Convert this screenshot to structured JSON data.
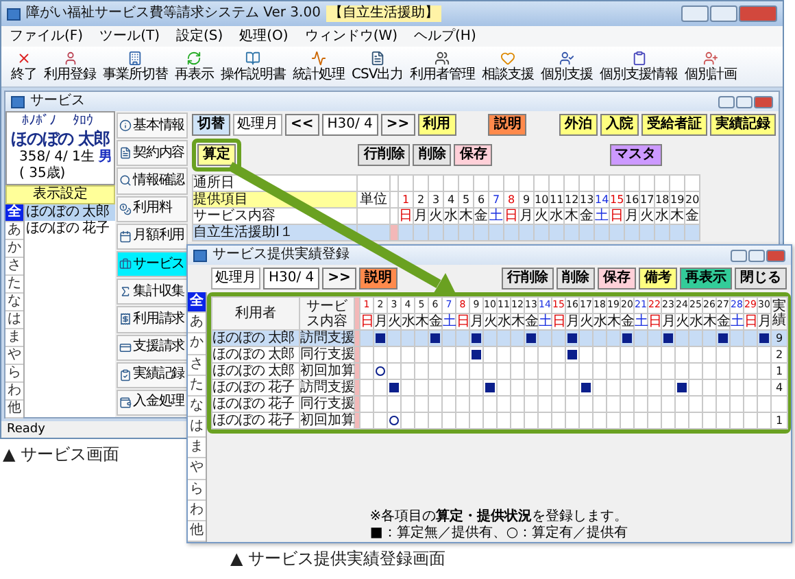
{
  "app": {
    "title": "障がい福祉サービス費等請求システム Ver 3.00",
    "badge": "【自立生活援助】",
    "menu": [
      "ファイル(F)",
      "ツール(T)",
      "設定(S)",
      "処理(O)",
      "ウィンドウ(W)",
      "ヘルプ(H)"
    ],
    "toolbar": [
      "終了",
      "利用登録",
      "事業所切替",
      "再表示",
      "操作説明書",
      "統計処理",
      "CSV出力",
      "利用者管理",
      "相談支援",
      "個別支援",
      "個別支援情報",
      "個別計画"
    ],
    "status": "Ready"
  },
  "service_window": {
    "title": "サービス",
    "user": {
      "furigana_family": "ﾎﾉﾎﾞﾉ",
      "furigana_given": "ﾀﾛｳ",
      "name": "ほのぼの 太郎",
      "birth": "358/ 4/ 1生",
      "gender": "男",
      "age": "( 35歳)"
    },
    "display_settings": "表示設定",
    "kana": [
      {
        "label": "全",
        "selected": true
      },
      {
        "label": "あ",
        "selected": false
      },
      {
        "label": "か",
        "selected": false
      },
      {
        "label": "さ",
        "selected": false
      },
      {
        "label": "た",
        "selected": false
      },
      {
        "label": "な",
        "selected": false
      },
      {
        "label": "は",
        "selected": false
      },
      {
        "label": "ま",
        "selected": false
      },
      {
        "label": "や",
        "selected": false
      },
      {
        "label": "ら",
        "selected": false
      },
      {
        "label": "わ",
        "selected": false
      },
      {
        "label": "他",
        "selected": false
      }
    ],
    "users": [
      {
        "name": "ほのぼの 太郎",
        "selected": true
      },
      {
        "name": "ほのぼの 花子",
        "selected": false
      }
    ],
    "nav": [
      {
        "label": "基本情報",
        "selected": false
      },
      {
        "label": "契約内容",
        "selected": false
      },
      {
        "label": "情報確認",
        "selected": false
      },
      {
        "label": "利用料",
        "selected": false
      },
      {
        "label": "月額利用",
        "selected": false
      },
      {
        "label": "サービス",
        "selected": true
      },
      {
        "label": "集計収集",
        "selected": false
      },
      {
        "label": "利用請求",
        "selected": false
      },
      {
        "label": "支援請求",
        "selected": false
      },
      {
        "label": "実績記録",
        "selected": false
      },
      {
        "label": "入金処理",
        "selected": false
      }
    ],
    "month_controls": [
      {
        "kind": "button",
        "label": "切替",
        "color": "#cfe3f7"
      },
      {
        "kind": "label",
        "label": "処理月"
      },
      {
        "kind": "button",
        "label": "<<",
        "color": "#f4f4f4"
      },
      {
        "kind": "field",
        "label": "H30/ 4"
      },
      {
        "kind": "button",
        "label": ">>",
        "color": "#f4f4f4"
      },
      {
        "kind": "button",
        "label": "利用",
        "color": "#ffff80"
      }
    ],
    "help_button": {
      "label": "説明",
      "color": "#ff8a4c"
    },
    "stay_buttons": [
      {
        "label": "外泊",
        "color": "#ffff80"
      },
      {
        "label": "入院",
        "color": "#ffff80"
      },
      {
        "label": "受給者証",
        "color": "#ffff80"
      },
      {
        "label": "実績記録",
        "color": "#ffff80"
      }
    ],
    "calc_button": {
      "label": "算定",
      "color": "#ffff99",
      "highlighted": true
    },
    "edit_buttons": [
      {
        "label": "行削除",
        "color": "#e4e4e4"
      },
      {
        "label": "削除",
        "color": "#e4e4e4"
      },
      {
        "label": "保存",
        "color": "#ffd0d8"
      }
    ],
    "master_button": {
      "label": "マスタ",
      "color": "#cc99ff"
    },
    "grid": {
      "visit_label": "通所日",
      "item_label": "提供項目",
      "unit_label": "単位",
      "content_label": "サービス内容",
      "days": [
        {
          "day": "1",
          "weekday": "日",
          "kind": "sunday"
        },
        {
          "day": "2",
          "weekday": "月",
          "kind": "weekday"
        },
        {
          "day": "3",
          "weekday": "火",
          "kind": "weekday"
        },
        {
          "day": "4",
          "weekday": "水",
          "kind": "weekday"
        },
        {
          "day": "5",
          "weekday": "木",
          "kind": "weekday"
        },
        {
          "day": "6",
          "weekday": "金",
          "kind": "weekday"
        },
        {
          "day": "7",
          "weekday": "土",
          "kind": "saturday"
        },
        {
          "day": "8",
          "weekday": "日",
          "kind": "sunday"
        },
        {
          "day": "9",
          "weekday": "月",
          "kind": "weekday"
        },
        {
          "day": "10",
          "weekday": "火",
          "kind": "weekday"
        },
        {
          "day": "11",
          "weekday": "水",
          "kind": "weekday"
        },
        {
          "day": "12",
          "weekday": "木",
          "kind": "weekday"
        },
        {
          "day": "13",
          "weekday": "金",
          "kind": "weekday"
        },
        {
          "day": "14",
          "weekday": "土",
          "kind": "saturday"
        },
        {
          "day": "15",
          "weekday": "日",
          "kind": "sunday"
        },
        {
          "day": "16",
          "weekday": "月",
          "kind": "weekday"
        },
        {
          "day": "17",
          "weekday": "火",
          "kind": "weekday"
        },
        {
          "day": "18",
          "weekday": "水",
          "kind": "weekday"
        },
        {
          "day": "19",
          "weekday": "木",
          "kind": "weekday"
        },
        {
          "day": "20",
          "weekday": "金",
          "kind": "weekday"
        }
      ],
      "rows": [
        {
          "label": "自立生活援助Ⅰ１",
          "selected": true
        }
      ]
    }
  },
  "caption_1": "▲ サービス画面",
  "entry_window": {
    "title": "サービス提供実績登録",
    "month_label": "処理月",
    "month": "H30/ 4",
    "next": ">>",
    "help_button": {
      "label": "説明",
      "color": "#ff8a4c"
    },
    "buttons": [
      {
        "label": "行削除",
        "color": "#e4e4e4"
      },
      {
        "label": "削除",
        "color": "#e4e4e4"
      },
      {
        "label": "保存",
        "color": "#ffd0d8"
      },
      {
        "label": "備考",
        "color": "#ffff80"
      },
      {
        "label": "再表示",
        "color": "#33cc99"
      },
      {
        "label": "閉じる",
        "color": "#e4e4e4"
      }
    ],
    "kana": [
      {
        "label": "全",
        "selected": true
      },
      {
        "label": "あ",
        "selected": false
      },
      {
        "label": "か",
        "selected": false
      },
      {
        "label": "さ",
        "selected": false
      },
      {
        "label": "た",
        "selected": false
      },
      {
        "label": "な",
        "selected": false
      },
      {
        "label": "は",
        "selected": false
      },
      {
        "label": "ま",
        "selected": false
      },
      {
        "label": "や",
        "selected": false
      },
      {
        "label": "ら",
        "selected": false
      },
      {
        "label": "わ",
        "selected": false
      },
      {
        "label": "他",
        "selected": false
      }
    ],
    "grid": {
      "highlighted": true,
      "user_label": "利用者",
      "content_label": "サービス内容",
      "count_label": "実績",
      "days": [
        {
          "day": "1",
          "weekday": "日",
          "kind": "sunday"
        },
        {
          "day": "2",
          "weekday": "月",
          "kind": "weekday"
        },
        {
          "day": "3",
          "weekday": "火",
          "kind": "weekday"
        },
        {
          "day": "4",
          "weekday": "水",
          "kind": "weekday"
        },
        {
          "day": "5",
          "weekday": "木",
          "kind": "weekday"
        },
        {
          "day": "6",
          "weekday": "金",
          "kind": "weekday"
        },
        {
          "day": "7",
          "weekday": "土",
          "kind": "saturday"
        },
        {
          "day": "8",
          "weekday": "日",
          "kind": "sunday"
        },
        {
          "day": "9",
          "weekday": "月",
          "kind": "weekday"
        },
        {
          "day": "10",
          "weekday": "火",
          "kind": "weekday"
        },
        {
          "day": "11",
          "weekday": "水",
          "kind": "weekday"
        },
        {
          "day": "12",
          "weekday": "木",
          "kind": "weekday"
        },
        {
          "day": "13",
          "weekday": "金",
          "kind": "weekday"
        },
        {
          "day": "14",
          "weekday": "土",
          "kind": "saturday"
        },
        {
          "day": "15",
          "weekday": "日",
          "kind": "sunday"
        },
        {
          "day": "16",
          "weekday": "月",
          "kind": "weekday"
        },
        {
          "day": "17",
          "weekday": "火",
          "kind": "weekday"
        },
        {
          "day": "18",
          "weekday": "水",
          "kind": "weekday"
        },
        {
          "day": "19",
          "weekday": "木",
          "kind": "weekday"
        },
        {
          "day": "20",
          "weekday": "金",
          "kind": "weekday"
        },
        {
          "day": "21",
          "weekday": "土",
          "kind": "saturday"
        },
        {
          "day": "22",
          "weekday": "日",
          "kind": "sunday"
        },
        {
          "day": "23",
          "weekday": "月",
          "kind": "weekday"
        },
        {
          "day": "24",
          "weekday": "火",
          "kind": "weekday"
        },
        {
          "day": "25",
          "weekday": "水",
          "kind": "weekday"
        },
        {
          "day": "26",
          "weekday": "木",
          "kind": "weekday"
        },
        {
          "day": "27",
          "weekday": "金",
          "kind": "weekday"
        },
        {
          "day": "28",
          "weekday": "土",
          "kind": "saturday"
        },
        {
          "day": "29",
          "weekday": "日",
          "kind": "sunday"
        },
        {
          "day": "30",
          "weekday": "月",
          "kind": "weekday"
        }
      ],
      "rows": [
        {
          "user": "ほのぼの 太郎",
          "service": "訪問支援",
          "selected": true,
          "count": "9",
          "cells": [
            {
              "kind": "none"
            },
            {
              "kind": "square"
            },
            {
              "kind": "none"
            },
            {
              "kind": "none"
            },
            {
              "kind": "none"
            },
            {
              "kind": "square"
            },
            {
              "kind": "none"
            },
            {
              "kind": "none"
            },
            {
              "kind": "square"
            },
            {
              "kind": "none"
            },
            {
              "kind": "none"
            },
            {
              "kind": "none"
            },
            {
              "kind": "square"
            },
            {
              "kind": "none"
            },
            {
              "kind": "none"
            },
            {
              "kind": "square"
            },
            {
              "kind": "none"
            },
            {
              "kind": "none"
            },
            {
              "kind": "none"
            },
            {
              "kind": "square"
            },
            {
              "kind": "none"
            },
            {
              "kind": "none"
            },
            {
              "kind": "square"
            },
            {
              "kind": "none"
            },
            {
              "kind": "none"
            },
            {
              "kind": "none"
            },
            {
              "kind": "square"
            },
            {
              "kind": "none"
            },
            {
              "kind": "none"
            },
            {
              "kind": "square"
            }
          ]
        },
        {
          "user": "ほのぼの 太郎",
          "service": "同行支援",
          "selected": false,
          "count": "2",
          "cells": [
            {
              "kind": "none"
            },
            {
              "kind": "none"
            },
            {
              "kind": "none"
            },
            {
              "kind": "none"
            },
            {
              "kind": "none"
            },
            {
              "kind": "none"
            },
            {
              "kind": "none"
            },
            {
              "kind": "none"
            },
            {
              "kind": "square"
            },
            {
              "kind": "none"
            },
            {
              "kind": "none"
            },
            {
              "kind": "none"
            },
            {
              "kind": "none"
            },
            {
              "kind": "none"
            },
            {
              "kind": "none"
            },
            {
              "kind": "square"
            },
            {
              "kind": "none"
            },
            {
              "kind": "none"
            },
            {
              "kind": "none"
            },
            {
              "kind": "none"
            },
            {
              "kind": "none"
            },
            {
              "kind": "none"
            },
            {
              "kind": "none"
            },
            {
              "kind": "none"
            },
            {
              "kind": "none"
            },
            {
              "kind": "none"
            },
            {
              "kind": "none"
            },
            {
              "kind": "none"
            },
            {
              "kind": "none"
            },
            {
              "kind": "none"
            }
          ]
        },
        {
          "user": "ほのぼの 太郎",
          "service": "初回加算",
          "selected": false,
          "count": "1",
          "cells": [
            {
              "kind": "none"
            },
            {
              "kind": "circle"
            },
            {
              "kind": "none"
            },
            {
              "kind": "none"
            },
            {
              "kind": "none"
            },
            {
              "kind": "none"
            },
            {
              "kind": "none"
            },
            {
              "kind": "none"
            },
            {
              "kind": "none"
            },
            {
              "kind": "none"
            },
            {
              "kind": "none"
            },
            {
              "kind": "none"
            },
            {
              "kind": "none"
            },
            {
              "kind": "none"
            },
            {
              "kind": "none"
            },
            {
              "kind": "none"
            },
            {
              "kind": "none"
            },
            {
              "kind": "none"
            },
            {
              "kind": "none"
            },
            {
              "kind": "none"
            },
            {
              "kind": "none"
            },
            {
              "kind": "none"
            },
            {
              "kind": "none"
            },
            {
              "kind": "none"
            },
            {
              "kind": "none"
            },
            {
              "kind": "none"
            },
            {
              "kind": "none"
            },
            {
              "kind": "none"
            },
            {
              "kind": "none"
            },
            {
              "kind": "none"
            }
          ]
        },
        {
          "user": "ほのぼの 花子",
          "service": "訪問支援",
          "selected": false,
          "count": "4",
          "cells": [
            {
              "kind": "none"
            },
            {
              "kind": "none"
            },
            {
              "kind": "square"
            },
            {
              "kind": "none"
            },
            {
              "kind": "none"
            },
            {
              "kind": "none"
            },
            {
              "kind": "none"
            },
            {
              "kind": "none"
            },
            {
              "kind": "none"
            },
            {
              "kind": "square"
            },
            {
              "kind": "none"
            },
            {
              "kind": "none"
            },
            {
              "kind": "none"
            },
            {
              "kind": "none"
            },
            {
              "kind": "none"
            },
            {
              "kind": "none"
            },
            {
              "kind": "square"
            },
            {
              "kind": "none"
            },
            {
              "kind": "none"
            },
            {
              "kind": "none"
            },
            {
              "kind": "none"
            },
            {
              "kind": "none"
            },
            {
              "kind": "none"
            },
            {
              "kind": "square"
            },
            {
              "kind": "none"
            },
            {
              "kind": "none"
            },
            {
              "kind": "none"
            },
            {
              "kind": "none"
            },
            {
              "kind": "none"
            },
            {
              "kind": "none"
            }
          ]
        },
        {
          "user": "ほのぼの 花子",
          "service": "同行支援",
          "selected": false,
          "cells": [
            {
              "kind": "none"
            },
            {
              "kind": "none"
            },
            {
              "kind": "none"
            },
            {
              "kind": "none"
            },
            {
              "kind": "none"
            },
            {
              "kind": "none"
            },
            {
              "kind": "none"
            },
            {
              "kind": "none"
            },
            {
              "kind": "none"
            },
            {
              "kind": "none"
            },
            {
              "kind": "none"
            },
            {
              "kind": "none"
            },
            {
              "kind": "none"
            },
            {
              "kind": "none"
            },
            {
              "kind": "none"
            },
            {
              "kind": "none"
            },
            {
              "kind": "none"
            },
            {
              "kind": "none"
            },
            {
              "kind": "none"
            },
            {
              "kind": "none"
            },
            {
              "kind": "none"
            },
            {
              "kind": "none"
            },
            {
              "kind": "none"
            },
            {
              "kind": "none"
            },
            {
              "kind": "none"
            },
            {
              "kind": "none"
            },
            {
              "kind": "none"
            },
            {
              "kind": "none"
            },
            {
              "kind": "none"
            },
            {
              "kind": "none"
            }
          ]
        },
        {
          "user": "ほのぼの 花子",
          "service": "初回加算",
          "selected": false,
          "count": "1",
          "cells": [
            {
              "kind": "none"
            },
            {
              "kind": "none"
            },
            {
              "kind": "circle"
            },
            {
              "kind": "none"
            },
            {
              "kind": "none"
            },
            {
              "kind": "none"
            },
            {
              "kind": "none"
            },
            {
              "kind": "none"
            },
            {
              "kind": "none"
            },
            {
              "kind": "none"
            },
            {
              "kind": "none"
            },
            {
              "kind": "none"
            },
            {
              "kind": "none"
            },
            {
              "kind": "none"
            },
            {
              "kind": "none"
            },
            {
              "kind": "none"
            },
            {
              "kind": "none"
            },
            {
              "kind": "none"
            },
            {
              "kind": "none"
            },
            {
              "kind": "none"
            },
            {
              "kind": "none"
            },
            {
              "kind": "none"
            },
            {
              "kind": "none"
            },
            {
              "kind": "none"
            },
            {
              "kind": "none"
            },
            {
              "kind": "none"
            },
            {
              "kind": "none"
            },
            {
              "kind": "none"
            },
            {
              "kind": "none"
            },
            {
              "kind": "none"
            }
          ]
        }
      ]
    },
    "note": "※各項目の**算定・提供状況**を登録します。",
    "legend": "■：算定無／提供有、○：算定有／提供有"
  },
  "caption_2": "▲ サービス提供実績登録画面"
}
